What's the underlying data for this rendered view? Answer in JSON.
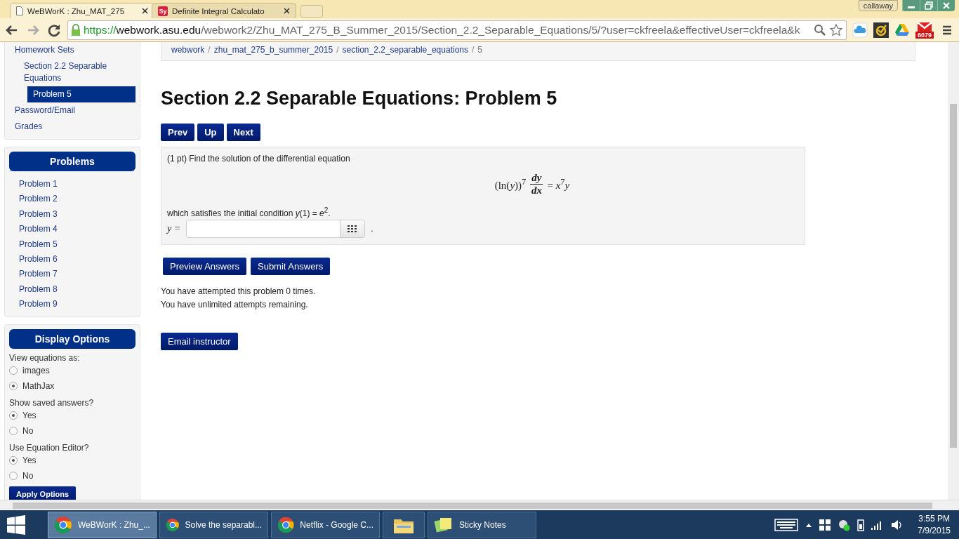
{
  "browser": {
    "tabs": [
      {
        "title": "WeBWorK : Zhu_MAT_275",
        "selected": true,
        "kind": "page"
      },
      {
        "title": "Definite Integral Calculato",
        "selected": false,
        "kind": "site",
        "icon_text": "Sy"
      }
    ],
    "profile": "callaway",
    "url": {
      "scheme": "https://",
      "host": "webwork.asu.edu",
      "path": "/webwork2/Zhu_MAT_275_B_Summer_2015/Section_2.2_Separable_Equations/5/?user=ckfreela&effectiveUser=ckfreela&k"
    },
    "extension_badge": "6079"
  },
  "sidebar": {
    "nav": [
      {
        "label": "Homework Sets",
        "selected": false,
        "children": [
          {
            "label": "Section 2.2 Separable Equations",
            "selected": false,
            "children": [
              {
                "label": "Problem 5",
                "selected": true
              }
            ]
          }
        ]
      },
      {
        "label": "Password/Email",
        "selected": false
      },
      {
        "label": "Grades",
        "selected": false
      }
    ],
    "problems": {
      "title": "Problems",
      "items": [
        "Problem 1",
        "Problem 2",
        "Problem 3",
        "Problem 4",
        "Problem 5",
        "Problem 6",
        "Problem 7",
        "Problem 8",
        "Problem 9"
      ]
    },
    "display_options": {
      "title": "Display Options",
      "groups": [
        {
          "label": "View equations as:",
          "options": [
            {
              "label": "images",
              "checked": false
            },
            {
              "label": "MathJax",
              "checked": true
            }
          ]
        },
        {
          "label": "Show saved answers?",
          "options": [
            {
              "label": "Yes",
              "checked": true
            },
            {
              "label": "No",
              "checked": false
            }
          ]
        },
        {
          "label": "Use Equation Editor?",
          "options": [
            {
              "label": "Yes",
              "checked": true
            },
            {
              "label": "No",
              "checked": false
            }
          ]
        }
      ],
      "apply": "Apply Options"
    }
  },
  "breadcrumb": [
    {
      "label": "webwork",
      "current": false,
      "separator": "/"
    },
    {
      "label": "zhu_mat_275_b_summer_2015",
      "current": false,
      "separator": "/"
    },
    {
      "label": "section_2.2_separable_equations",
      "current": false,
      "separator": "/"
    },
    {
      "label": "5",
      "current": true
    }
  ],
  "heading": "Section 2.2 Separable Equations: Problem 5",
  "nav_buttons": [
    "Prev",
    "Up",
    "Next"
  ],
  "problem": {
    "intro": "(1 pt) Find the solution of the differential equation",
    "equation": {
      "left": "(ln(*y*))$^{7}$",
      "numerator": "dy",
      "denominator": "dx",
      "right": "= *x*$^{7}$*y*"
    },
    "condition": "which satisfies the initial condition *y*(1) = *e*$^{2}$.",
    "answer_label": "y =",
    "after_field": "."
  },
  "submit_buttons": [
    "Preview Answers",
    "Submit Answers"
  ],
  "attempts": [
    "You have attempted this problem 0 times.",
    "You have unlimited attempts remaining."
  ],
  "email_button": "Email instructor",
  "taskbar": {
    "items": [
      {
        "label": "WeBWorK : Zhu_...",
        "kind": "browser",
        "selected": true
      },
      {
        "label": "Solve the separabl...",
        "kind": "browser",
        "selected": false
      },
      {
        "label": "Netflix - Google C...",
        "kind": "browser",
        "selected": false
      },
      {
        "kind": "folder",
        "selected": false
      },
      {
        "label": "Sticky Notes",
        "kind": "notes",
        "selected": false
      }
    ],
    "time": "3:55 PM",
    "date": "7/9/2015"
  }
}
